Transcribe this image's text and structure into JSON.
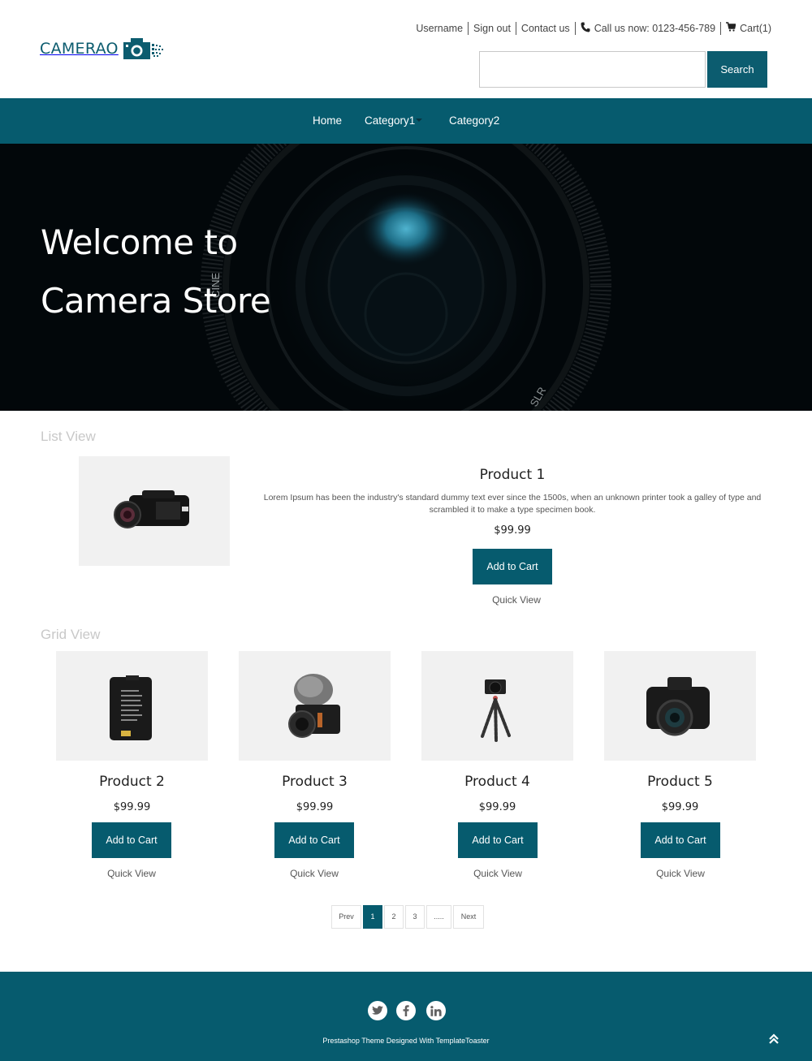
{
  "brand": {
    "logo_text": "CAMERAO",
    "accent": "#065b6e"
  },
  "toplinks": {
    "username": "Username",
    "sign_out": "Sign out",
    "contact": "Contact us",
    "phone": "Call us now: 0123-456-789",
    "cart": "Cart(1)",
    "phone_icon": "phone-icon",
    "cart_icon": "cart-icon"
  },
  "search": {
    "value": "",
    "placeholder": "",
    "button_label": "Search"
  },
  "nav": {
    "items": [
      {
        "label": "Home"
      },
      {
        "label": "Category1",
        "has_dropdown": true
      },
      {
        "label": "Category2"
      }
    ]
  },
  "hero": {
    "line1": "Welcome to",
    "line2": "Camera Store"
  },
  "list_view": {
    "heading": "List View",
    "product": {
      "name": "Product 1",
      "description": "Lorem Ipsum has been the industry's standard dummy text ever since the 1500s, when an unknown printer took a galley of type and scrambled it to make a type specimen book.",
      "price": "$99.99",
      "add_to_cart": "Add to Cart",
      "quick_view": "Quick View",
      "image": "camcorder"
    }
  },
  "grid_view": {
    "heading": "Grid View",
    "products": [
      {
        "name": "Product 2",
        "price": "$99.99",
        "add_to_cart": "Add to Cart",
        "quick_view": "Quick View",
        "image": "battery"
      },
      {
        "name": "Product 3",
        "price": "$99.99",
        "add_to_cart": "Add to Cart",
        "quick_view": "Quick View",
        "image": "mirrorless-camera-with-mic"
      },
      {
        "name": "Product 4",
        "price": "$99.99",
        "add_to_cart": "Add to Cart",
        "quick_view": "Quick View",
        "image": "camera-on-tripod"
      },
      {
        "name": "Product 5",
        "price": "$99.99",
        "add_to_cart": "Add to Cart",
        "quick_view": "Quick View",
        "image": "dslr-camera"
      }
    ]
  },
  "pagination": {
    "prev": "Prev",
    "pages": [
      "1",
      "2",
      "3",
      "....."
    ],
    "active": "1",
    "next": "Next"
  },
  "footer": {
    "social": [
      {
        "name": "twitter",
        "glyph": "t"
      },
      {
        "name": "facebook",
        "glyph": "f"
      },
      {
        "name": "linkedin",
        "glyph": "in"
      }
    ],
    "credit": "Prestashop Theme Designed With TemplateToaster",
    "back_to_top_icon": "double-chevron-up-icon"
  }
}
